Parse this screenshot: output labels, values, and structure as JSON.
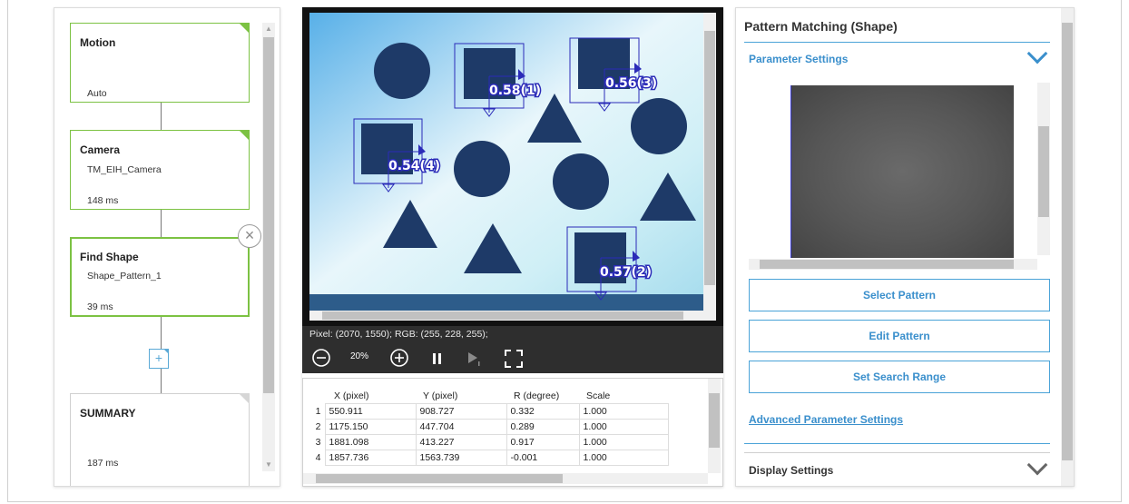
{
  "flow": {
    "nodes": [
      {
        "title": "Motion",
        "line": "",
        "time": "Auto"
      },
      {
        "title": "Camera",
        "line": "TM_EIH_Camera",
        "time": "148 ms"
      },
      {
        "title": "Find Shape",
        "line": "Shape_Pattern_1",
        "time": "39 ms"
      },
      {
        "title": "SUMMARY",
        "line": "",
        "time": "187 ms"
      }
    ],
    "close_glyph": "×",
    "add_glyph": "+"
  },
  "viewer": {
    "labels": [
      {
        "text": "0.58(1)"
      },
      {
        "text": "0.56(3)"
      },
      {
        "text": "0.54(4)"
      },
      {
        "text": "0.57(2)"
      }
    ],
    "pixel_info": "Pixel: (2070, 1550); RGB: (255, 228, 255);",
    "zoom": "20%"
  },
  "results": {
    "headers": [
      "X (pixel)",
      "Y (pixel)",
      "R (degree)",
      "Scale"
    ],
    "rows": [
      {
        "idx": "1",
        "x": "550.911",
        "y": "908.727",
        "r": "0.332",
        "s": "1.000"
      },
      {
        "idx": "2",
        "x": "1175.150",
        "y": "447.704",
        "r": "0.289",
        "s": "1.000"
      },
      {
        "idx": "3",
        "x": "1881.098",
        "y": "413.227",
        "r": "0.917",
        "s": "1.000"
      },
      {
        "idx": "4",
        "x": "1857.736",
        "y": "1563.739",
        "r": "-0.001",
        "s": "1.000"
      }
    ]
  },
  "settings": {
    "title": "Pattern Matching (Shape)",
    "parameter_settings": "Parameter Settings",
    "select_pattern": "Select Pattern",
    "edit_pattern": "Edit Pattern",
    "set_search_range": "Set Search Range",
    "advanced": "Advanced Parameter Settings",
    "display_settings": "Display Settings"
  },
  "colors": {
    "accent_green": "#7cc243",
    "accent_blue": "#3a8fcc",
    "match_box": "#2b2bb8",
    "shape_fill": "#1e3a68"
  }
}
